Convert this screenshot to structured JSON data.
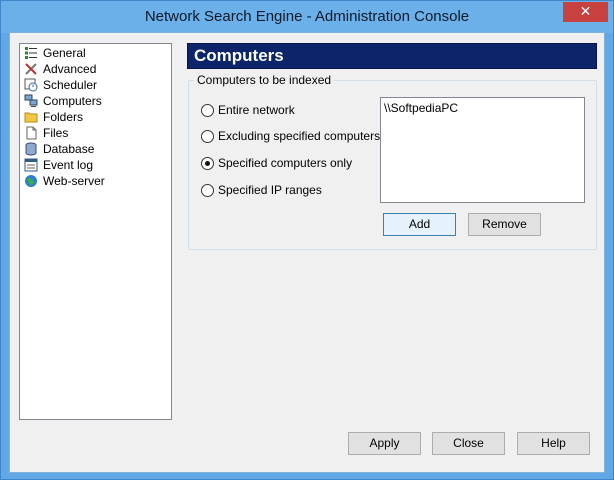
{
  "window": {
    "title": "Network Search Engine - Administration Console",
    "close_glyph": "✕"
  },
  "tree": {
    "items": [
      {
        "label": "General",
        "icon": "general-list-icon"
      },
      {
        "label": "Advanced",
        "icon": "tools-icon"
      },
      {
        "label": "Scheduler",
        "icon": "scheduler-icon"
      },
      {
        "label": "Computers",
        "icon": "computers-icon"
      },
      {
        "label": "Folders",
        "icon": "folder-icon"
      },
      {
        "label": "Files",
        "icon": "file-icon"
      },
      {
        "label": "Database",
        "icon": "database-icon"
      },
      {
        "label": "Event log",
        "icon": "event-log-icon"
      },
      {
        "label": "Web-server",
        "icon": "globe-icon"
      }
    ]
  },
  "panel": {
    "title": "Computers",
    "group_label": "Computers to be indexed",
    "options": [
      {
        "label": "Entire network",
        "checked": false
      },
      {
        "label": "Excluding specified computers",
        "checked": false
      },
      {
        "label": "Specified computers only",
        "checked": true
      },
      {
        "label": "Specified IP ranges",
        "checked": false
      }
    ],
    "list_items": [
      "\\\\SoftpediaPC"
    ],
    "add_label": "Add",
    "remove_label": "Remove"
  },
  "footer": {
    "apply_label": "Apply",
    "close_label": "Close",
    "help_label": "Help"
  },
  "colors": {
    "header_bg": "#0b246a",
    "titlebar": "#6cb0ea",
    "close_btn": "#c7413f"
  }
}
